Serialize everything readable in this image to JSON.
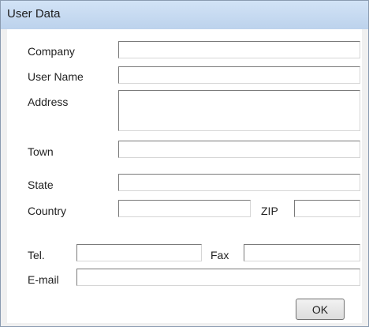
{
  "window": {
    "title": "User Data"
  },
  "form": {
    "company": {
      "label": "Company",
      "value": ""
    },
    "user_name": {
      "label": "User Name",
      "value": ""
    },
    "address": {
      "label": "Address",
      "value": ""
    },
    "town": {
      "label": "Town",
      "value": ""
    },
    "state": {
      "label": "State",
      "value": ""
    },
    "country": {
      "label": "Country",
      "value": ""
    },
    "zip": {
      "label": "ZIP",
      "value": ""
    },
    "tel": {
      "label": "Tel.",
      "value": ""
    },
    "fax": {
      "label": "Fax",
      "value": ""
    },
    "email": {
      "label": "E-mail",
      "value": ""
    }
  },
  "buttons": {
    "ok": "OK"
  }
}
